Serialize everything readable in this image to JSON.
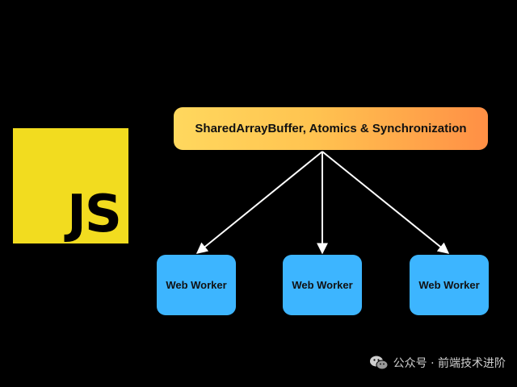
{
  "logo": {
    "text": "JS",
    "color": "#f2dc1f"
  },
  "diagram": {
    "top_node": {
      "label": "SharedArrayBuffer, Atomics & Synchronization",
      "gradient": [
        "#ffd85e",
        "#ffc350",
        "#ff8f45"
      ]
    },
    "workers": [
      {
        "label": "Web Worker"
      },
      {
        "label": "Web Worker"
      },
      {
        "label": "Web Worker"
      }
    ],
    "worker_color": "#3db5ff",
    "arrow_color": "#ffffff"
  },
  "watermark": {
    "icon": "wechat-icon",
    "text": "公众号 · 前端技术进阶"
  }
}
